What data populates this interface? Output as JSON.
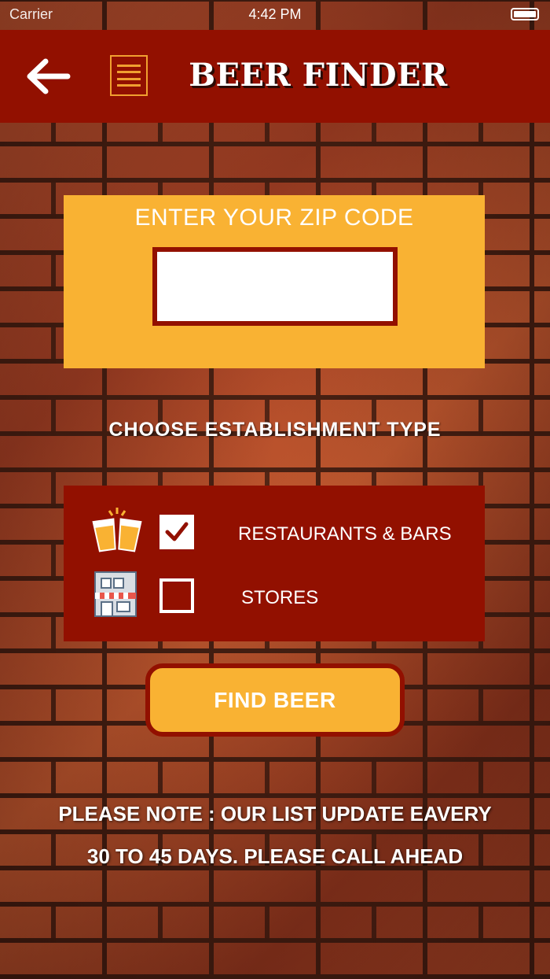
{
  "status_bar": {
    "carrier": "Carrier",
    "time": "4:42 PM"
  },
  "nav": {
    "title": "BEER FINDER",
    "back_icon": "arrow-left-icon",
    "menu_icon": "hamburger-menu-icon"
  },
  "zip": {
    "label": "ENTER YOUR ZIP CODE",
    "value": "",
    "placeholder": ""
  },
  "establishment": {
    "heading": "CHOOSE ESTABLISHMENT TYPE",
    "options": [
      {
        "label": "RESTAURANTS & BARS",
        "icon": "beer-glasses-icon",
        "checked": true
      },
      {
        "label": "STORES",
        "icon": "storefront-icon",
        "checked": false
      }
    ]
  },
  "actions": {
    "find_label": "FIND BEER"
  },
  "note": {
    "line1": "PLEASE NOTE : OUR LIST UPDATE EAVERY",
    "line2": "30 TO 45 DAYS. PLEASE CALL AHEAD"
  },
  "colors": {
    "primary_red": "#921000",
    "accent_yellow": "#f9b233",
    "text": "#ffffff"
  }
}
